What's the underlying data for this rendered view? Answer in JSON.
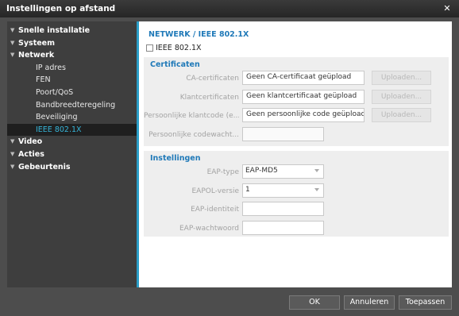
{
  "window": {
    "title": "Instellingen op afstand"
  },
  "sidebar": {
    "items": [
      {
        "label": "Snelle installatie",
        "level": "top"
      },
      {
        "label": "Systeem",
        "level": "top"
      },
      {
        "label": "Netwerk",
        "level": "top"
      },
      {
        "label": "IP adres",
        "level": "child"
      },
      {
        "label": "FEN",
        "level": "child"
      },
      {
        "label": "Poort/QoS",
        "level": "child"
      },
      {
        "label": "Bandbreedteregeling",
        "level": "child"
      },
      {
        "label": "Beveiliging",
        "level": "child"
      },
      {
        "label": "IEEE 802.1X",
        "level": "child",
        "selected": true
      },
      {
        "label": "Video",
        "level": "top"
      },
      {
        "label": "Acties",
        "level": "top"
      },
      {
        "label": "Gebeurtenis",
        "level": "top"
      }
    ]
  },
  "main": {
    "title": "NETWERK / IEEE 802.1X",
    "enable_label": "IEEE 802.1X",
    "certificates": {
      "title": "Certificaten",
      "ca_label": "CA-certificaten",
      "ca_value": "Geen CA-certificaat geüpload",
      "client_label": "Klantcertificaten",
      "client_value": "Geen klantcertificaat geüpload",
      "key_label": "Persoonlijke klantcode (e...",
      "key_value": "Geen persoonlijke code geüpload",
      "password_label": "Persoonlijke codewacht...",
      "upload_label": "Uploaden..."
    },
    "settings": {
      "title": "Instellingen",
      "eap_type_label": "EAP-type",
      "eap_type_value": "EAP-MD5",
      "eapol_label": "EAPOL-versie",
      "eapol_value": "1",
      "identity_label": "EAP-identiteit",
      "password_label": "EAP-wachtwoord"
    }
  },
  "footer": {
    "ok_label": "OK",
    "cancel_label": "Annuleren",
    "apply_label": "Toepassen"
  },
  "colors": {
    "accent": "#1f79b8",
    "selected": "#36b5d9"
  }
}
